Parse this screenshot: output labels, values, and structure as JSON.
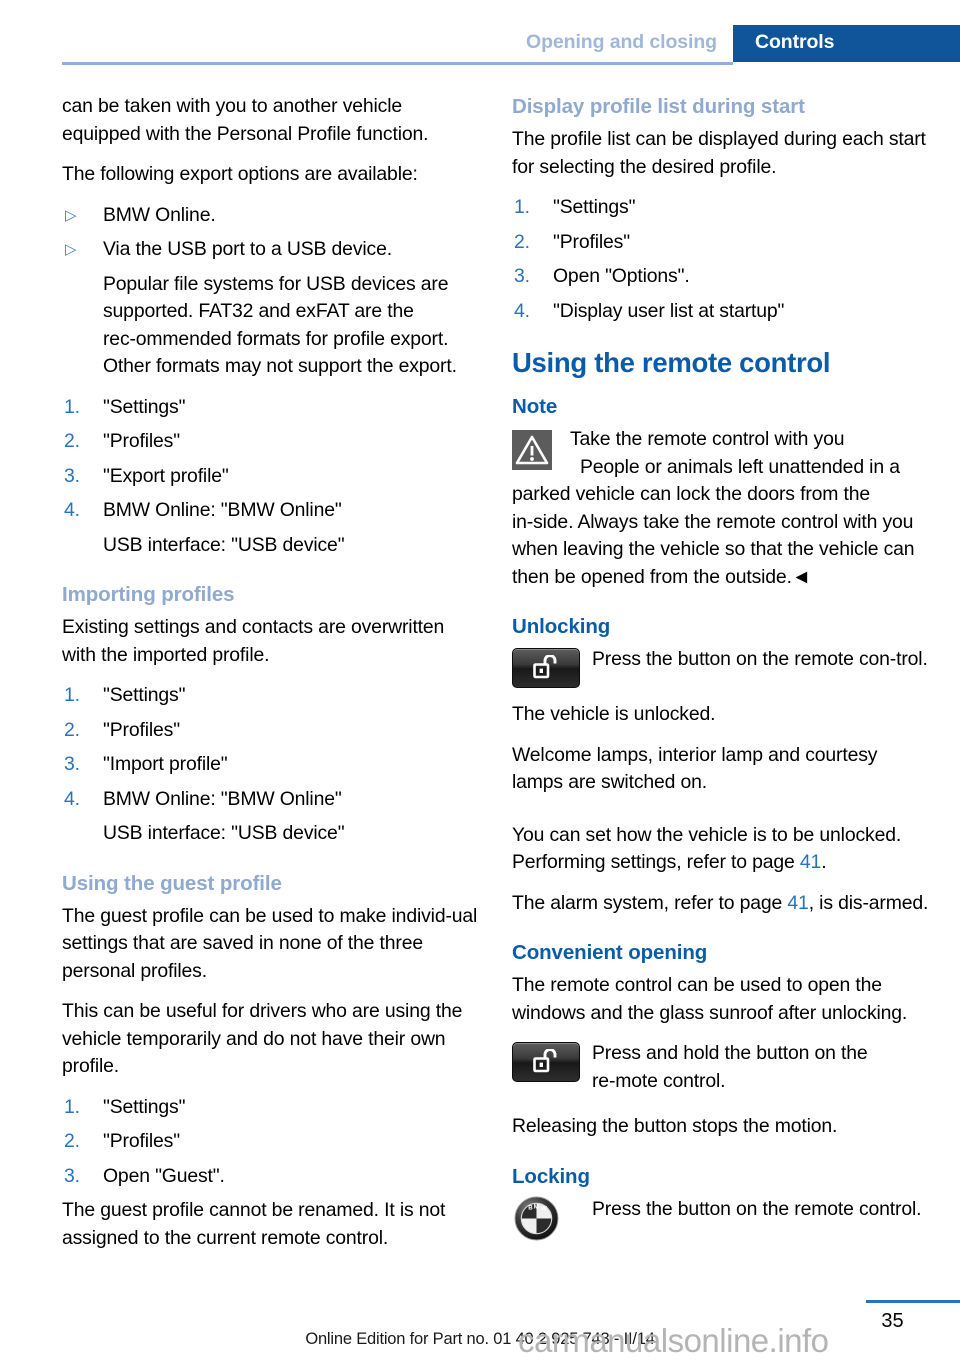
{
  "header": {
    "section_label": "Opening and closing",
    "chapter_label": "Controls",
    "banner_color": "#10559a",
    "section_color": "#9fb7d8"
  },
  "left_column": {
    "intro_paragraph": "can be taken with you to another vehicle equipped with the Personal Profile function.",
    "export_options_intro": "The following export options are available:",
    "export_bullets": [
      {
        "marker": "▷",
        "text": "BMW Online."
      },
      {
        "marker": "▷",
        "text": "Via the USB port to a USB device."
      }
    ],
    "usb_note": "Popular file systems for USB devices are supported. FAT32 and exFAT are the rec‑ommended formats for profile export. Other formats may not support the export.",
    "export_steps": [
      {
        "num": "1.",
        "text": "\"Settings\""
      },
      {
        "num": "2.",
        "text": "\"Profiles\""
      },
      {
        "num": "3.",
        "text": "\"Export profile\""
      },
      {
        "num": "4.",
        "text": "BMW Online: \"BMW Online\""
      }
    ],
    "export_step4_sub": "USB interface: \"USB device\"",
    "importing_heading": "Importing profiles",
    "importing_paragraph": "Existing settings and contacts are overwritten with the imported profile.",
    "import_steps": [
      {
        "num": "1.",
        "text": "\"Settings\""
      },
      {
        "num": "2.",
        "text": "\"Profiles\""
      },
      {
        "num": "3.",
        "text": "\"Import profile\""
      },
      {
        "num": "4.",
        "text": "BMW Online: \"BMW Online\""
      }
    ],
    "import_step4_sub": "USB interface: \"USB device\"",
    "guest_heading": "Using the guest profile",
    "guest_paragraph_1": "The guest profile can be used to make individ‑ual settings that are saved in none of the three personal profiles.",
    "guest_paragraph_2": "This can be useful for drivers who are using the vehicle temporarily and do not have their own profile.",
    "guest_steps": [
      {
        "num": "1.",
        "text": "\"Settings\""
      },
      {
        "num": "2.",
        "text": "\"Profiles\""
      },
      {
        "num": "3.",
        "text": "Open \"Guest\"."
      }
    ],
    "guest_paragraph_3": "The guest profile cannot be renamed. It is not assigned to the current remote control."
  },
  "right_column": {
    "display_list_heading": "Display profile list during start",
    "display_list_paragraph": "The profile list can be displayed during each start for selecting the desired profile.",
    "display_list_steps": [
      {
        "num": "1.",
        "text": "\"Settings\""
      },
      {
        "num": "2.",
        "text": "\"Profiles\""
      },
      {
        "num": "3.",
        "text": "Open \"Options\"."
      },
      {
        "num": "4.",
        "text": "\"Display user list at startup\""
      }
    ],
    "main_heading": "Using the remote control",
    "note_heading": "Note",
    "note_icon_name": "warning-triangle-icon",
    "note_title": "Take the remote control with you",
    "note_body": "People or animals left unattended in a parked vehicle can lock the doors from the in‑side. Always take the remote control with you when leaving the vehicle so that the vehicle can then be opened from the outside.◄",
    "unlocking_heading": "Unlocking",
    "unlocking_icon_name": "remote-unlock-button-icon",
    "unlocking_instruction": "Press the button on the remote con‑trol.",
    "unlocking_result": "The vehicle is unlocked.",
    "unlocking_lamps": "Welcome lamps, interior lamp and courtesy lamps are switched on.",
    "unlocking_settings_pre": "You can set how the vehicle is to be unlocked. Performing settings, refer to page ",
    "unlocking_settings_ref": "41",
    "unlocking_settings_post": ".",
    "alarm_pre": "The alarm system, refer to page ",
    "alarm_ref": "41",
    "alarm_post": ", is dis‑armed.",
    "convenient_heading": "Convenient opening",
    "convenient_paragraph": "The remote control can be used to open the windows and the glass sunroof after unlocking.",
    "convenient_icon_name": "remote-unlock-button-icon",
    "convenient_instruction": "Press and hold the button on the re‑mote control.",
    "convenient_release": "Releasing the button stops the motion.",
    "locking_heading": "Locking",
    "locking_icon_name": "bmw-roundel-logo-icon",
    "locking_instruction": "Press the button on the remote control."
  },
  "footer": {
    "edition_text": "Online Edition for Part no. 01 40 2 925 743 - II/14",
    "page_number": "35",
    "watermark": "carmanualsonline.info",
    "rule_color": "#2a72bd"
  }
}
